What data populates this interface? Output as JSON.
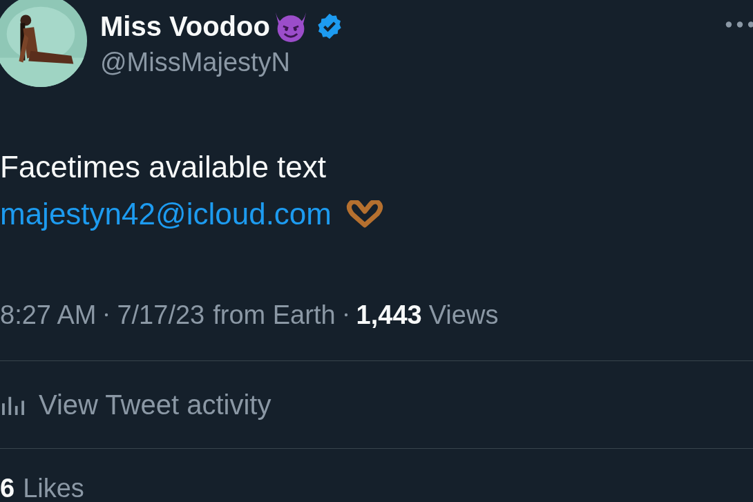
{
  "author": {
    "name": "Miss Voodoo",
    "handle": "@MissMajestyN",
    "verified": true
  },
  "tweet": {
    "text": "Facetimes available text",
    "link": "majestyn42@icloud.com"
  },
  "meta": {
    "time": "8:27 AM",
    "date": "7/17/23",
    "source": "from Earth",
    "views_count": "1,443",
    "views_label": "Views"
  },
  "activity": {
    "label": "View Tweet activity"
  },
  "stats": [
    {
      "count": "6",
      "label": "Likes"
    }
  ]
}
